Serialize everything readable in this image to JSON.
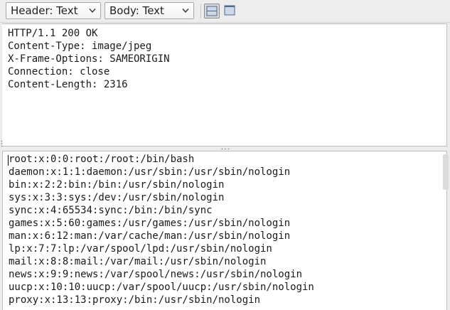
{
  "toolbar": {
    "header_select": {
      "value": "Header: Text",
      "icon": "chevron-down-icon"
    },
    "body_select": {
      "value": "Body: Text",
      "icon": "chevron-down-icon"
    },
    "layout_buttons": [
      {
        "icon": "split-view-icon",
        "active": true
      },
      {
        "icon": "single-view-icon",
        "active": false
      }
    ]
  },
  "response_headers": [
    "HTTP/1.1 200 OK",
    "Content-Type: image/jpeg",
    "X-Frame-Options: SAMEORIGIN",
    "Connection: close",
    "Content-Length: 2316"
  ],
  "response_body": [
    "root:x:0:0:root:/root:/bin/bash",
    "daemon:x:1:1:daemon:/usr/sbin:/usr/sbin/nologin",
    "bin:x:2:2:bin:/bin:/usr/sbin/nologin",
    "sys:x:3:3:sys:/dev:/usr/sbin/nologin",
    "sync:x:4:65534:sync:/bin:/bin/sync",
    "games:x:5:60:games:/usr/games:/usr/sbin/nologin",
    "man:x:6:12:man:/var/cache/man:/usr/sbin/nologin",
    "lp:x:7:7:lp:/var/spool/lpd:/usr/sbin/nologin",
    "mail:x:8:8:mail:/var/mail:/usr/sbin/nologin",
    "news:x:9:9:news:/var/spool/news:/usr/sbin/nologin",
    "uucp:x:10:10:uucp:/var/spool/uucp:/usr/sbin/nologin",
    "proxy:x:13:13:proxy:/bin:/usr/sbin/nologin"
  ],
  "colors": {
    "pane_background": "#ffffff",
    "toolbar_background": "#ededed",
    "text": "#1a1a1a"
  }
}
